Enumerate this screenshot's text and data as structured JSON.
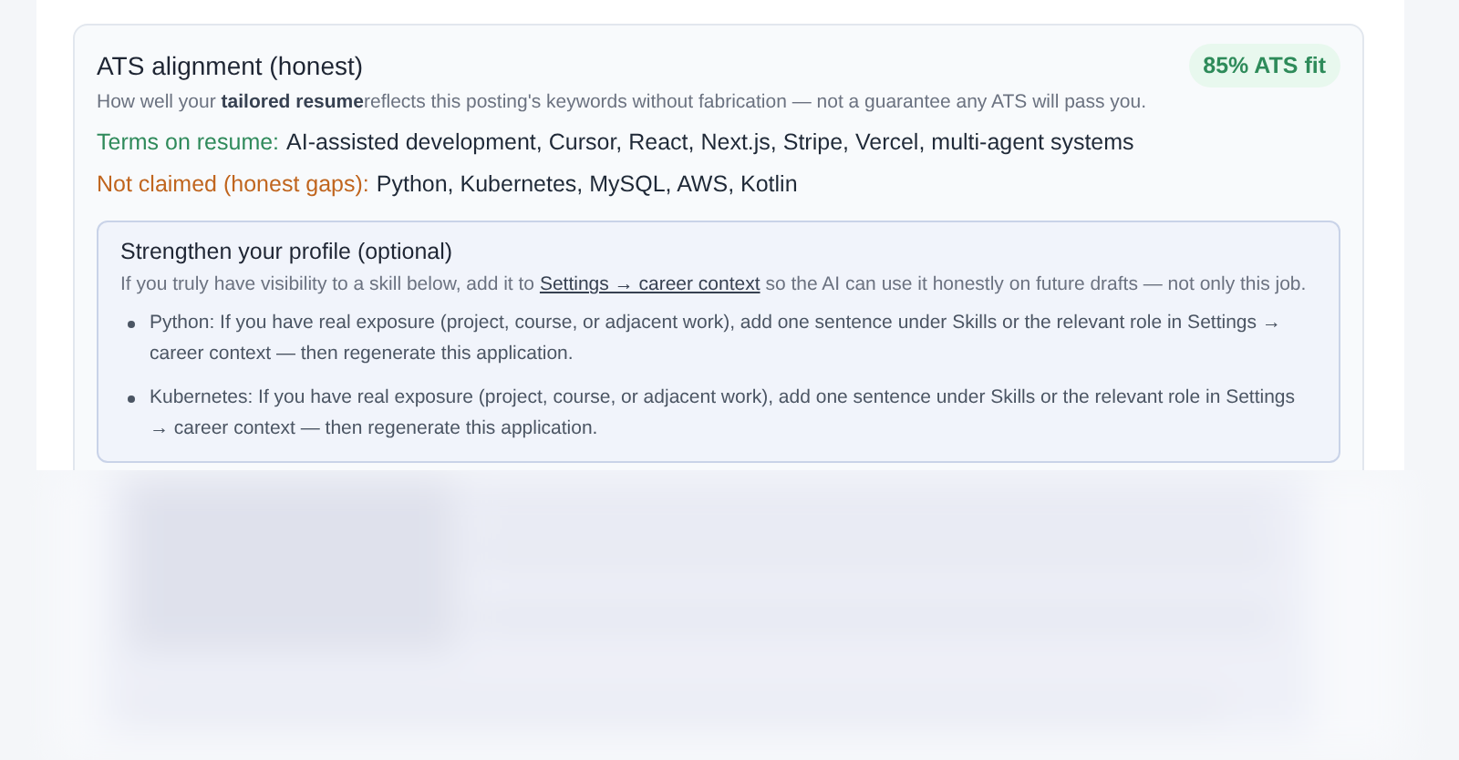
{
  "card": {
    "title": "ATS alignment (honest)",
    "badge": "85% ATS fit",
    "subtitle": "How well your **tailored resume**reflects this posting's keywords without fabrication — not a guarantee any ATS will pass you.",
    "term_lines": [
      {
        "kind": "claimed",
        "label": "Terms on resume:",
        "value": "AI-assisted development, Cursor, React, Next.js, Stripe, Vercel, multi-agent systems"
      },
      {
        "kind": "gaps",
        "label": "Not claimed (honest gaps):",
        "value": "Python, Kubernetes, MySQL, AWS, Kotlin"
      }
    ],
    "profile_box": {
      "title": "Strengthen your profile (optional)",
      "intro_before": "If you truly have visibility to a skill below, add it to",
      "intro_link": "Settings → career context",
      "intro_after": "so the AI can use it honestly on future drafts — not only this job.",
      "tips": [
        "Python: If you have real exposure (project, course, or adjacent work), add one sentence under Skills or the relevant role in Settings → career context — then regenerate this application.",
        "Kubernetes: If you have real exposure (project, course, or adjacent work), add one sentence under Skills or the relevant role in Settings → career context — then regenerate this application."
      ]
    }
  }
}
